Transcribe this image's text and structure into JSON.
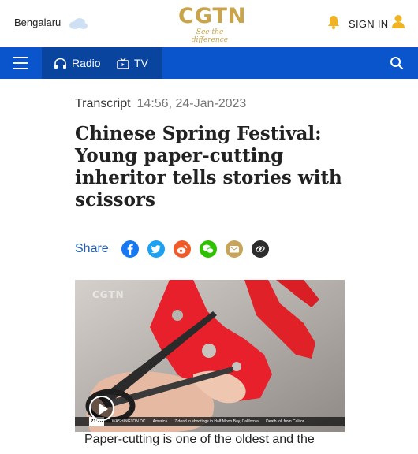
{
  "header": {
    "city": "Bengalaru",
    "logo_text": "CGTN",
    "logo_tagline": "See the difference",
    "sign_in": "SIGN IN"
  },
  "nav": {
    "radio": "Radio",
    "tv": "TV"
  },
  "article": {
    "section": "Transcript",
    "timestamp": "14:56, 24-Jan-2023",
    "title": "Chinese Spring Festival: Young paper-cutting inheritor tells stories with scissors",
    "share_label": "Share",
    "share_icons": [
      "facebook-icon",
      "twitter-icon",
      "weibo-icon",
      "wechat-icon",
      "email-icon",
      "link-icon"
    ],
    "first_line": "Paper-cutting is one of the oldest and the"
  },
  "video": {
    "watermark": "CGTN",
    "ticker_clock": "21:26",
    "ticker_items": [
      "WASHINGTON DC",
      "America",
      "7 dead in shootings in Half Moon Bay, California",
      "Death toll from Califor"
    ]
  },
  "colors": {
    "brand_gold": "#c9a44a",
    "nav_blue": "#0b55cc",
    "share_blue": "#1f5eb8"
  }
}
